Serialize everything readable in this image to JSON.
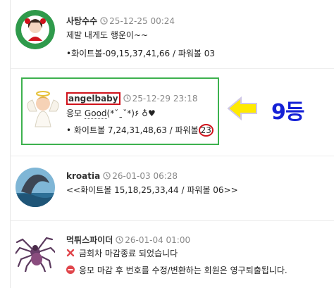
{
  "comments": [
    {
      "nick": "사탕수수",
      "time": "25-12-25 00:24",
      "lines": [
        "제발 내게도 행운이~~",
        "•화이트볼-09,15,37,41,66 / 파워볼 03"
      ]
    },
    {
      "nick": "angelbaby",
      "time": "25-12-29 23:18",
      "line1_prefix": "응모",
      "line1_good": "Good",
      "line1_suffix": "(*ˇˍˇ*)۶ ♁♥",
      "line2_prefix": "• 화이트볼 7,24,31,48,63 / 파워볼",
      "line2_power": "23"
    },
    {
      "nick": "kroatia",
      "time": "26-01-03 06:28",
      "lines": [
        "<<화이트볼 15,18,25,33,44 / 파워볼 06>>"
      ]
    },
    {
      "nick": "먹튀스파이더",
      "time": "26-01-04 01:00",
      "line1": "금회차 마감종료 되었습니다",
      "line2": "응모 마감 후 번호를 수정/변환하는 회원은 영구퇴출됩니다."
    }
  ],
  "annotation": {
    "rank_label": "9등"
  },
  "colors": {
    "highlight_box": "#3db14e",
    "mark_red": "#d0121b",
    "rank_blue": "#1521d6",
    "arrow_yellow": "#ffea00"
  },
  "icons": [
    "clock-icon",
    "x-icon",
    "no-entry-icon",
    "arrow-left-icon"
  ]
}
